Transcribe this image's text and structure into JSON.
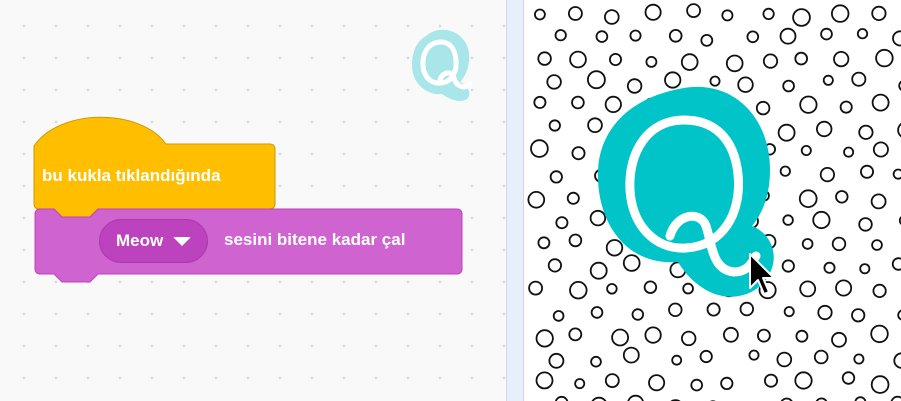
{
  "workspace": {
    "when_clicked_block": {
      "label": "bu kukla tıklandığında",
      "color": "#ffbf00"
    },
    "play_sound_block": {
      "sound_value": "Meow",
      "label": "sesini bitene kadar çal",
      "color": "#cf63cf"
    },
    "sprite_thumbnail": {
      "letter": "Q",
      "icon": "sprite-q-icon"
    }
  },
  "stage": {
    "sprite": {
      "letter": "Q",
      "color": "#00c4c8"
    },
    "backdrop": "polka-dots"
  }
}
